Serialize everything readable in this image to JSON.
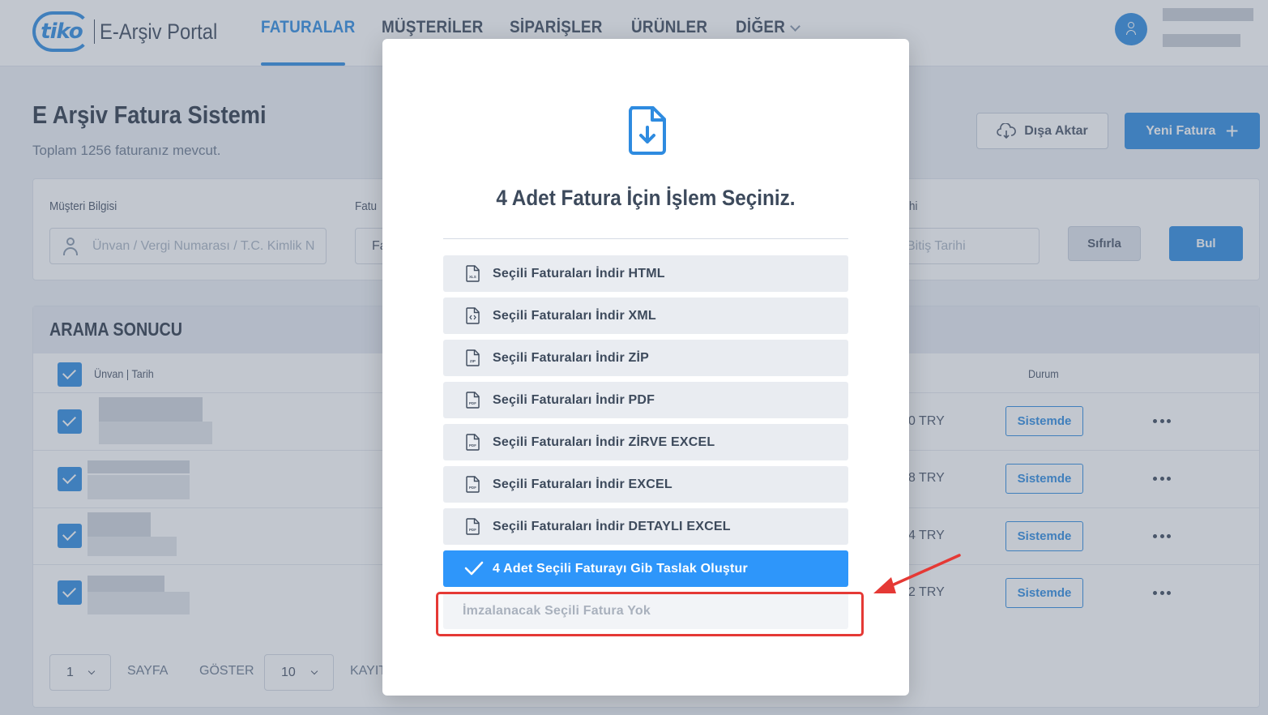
{
  "navbar": {
    "logo_mark": "tiko",
    "logo_text": "E-Arşiv Portal",
    "tabs": [
      {
        "label": "FATURALAR",
        "active": true
      },
      {
        "label": "MÜŞTERİLER",
        "active": false
      },
      {
        "label": "SİPARİŞLER",
        "active": false
      },
      {
        "label": "ÜRÜNLER",
        "active": false
      },
      {
        "label": "DİĞER",
        "active": false
      }
    ]
  },
  "page": {
    "title": "E Arşiv Fatura Sistemi",
    "subtitle": "Toplam 1256 faturanız mevcut.",
    "export_label": "Dışa Aktar",
    "new_invoice_label": "Yeni Fatura"
  },
  "filters": {
    "customer_label": "Müşteri Bilgisi",
    "customer_placeholder": "Ünvan / Vergi Numarası / T.C. Kimlik N",
    "invoice_label_partial": "Fatu",
    "invoice_input_partial": "Fa",
    "date_label_partial": "hi",
    "end_date_placeholder": "Bitiş Tarihi",
    "reset_label": "Sıfırla",
    "find_label": "Bul"
  },
  "results": {
    "title": "ARAMA SONUCU",
    "col_name_date": "Ünvan | Tarih",
    "col_status": "Durum",
    "rows": [
      {
        "amount": "0 TRY",
        "status": "Sistemde"
      },
      {
        "amount": "8 TRY",
        "status": "Sistemde"
      },
      {
        "amount": "4 TRY",
        "status": "Sistemde"
      },
      {
        "amount": "2 TRY",
        "status": "Sistemde"
      }
    ],
    "pager": {
      "page_value": "1",
      "page_label": "SAYFA",
      "show_label": "GÖSTER",
      "per_page_value": "10",
      "records_label_partial": "KAYIT"
    }
  },
  "modal": {
    "title": "4 Adet Fatura İçin İşlem Seçiniz.",
    "options": [
      {
        "label": "Seçili Faturaları İndir HTML",
        "icon": "xls-file-icon",
        "icon_tag": "XLS"
      },
      {
        "label": "Seçili Faturaları İndir XML",
        "icon": "code-file-icon",
        "icon_tag": ""
      },
      {
        "label": "Seçili Faturaları İndir ZİP",
        "icon": "zip-file-icon",
        "icon_tag": "ZIP"
      },
      {
        "label": "Seçili Faturaları İndir PDF",
        "icon": "pdf-file-icon",
        "icon_tag": "PDF"
      },
      {
        "label": "Seçili Faturaları İndir ZİRVE EXCEL",
        "icon": "pdf-file-icon",
        "icon_tag": "PDF"
      },
      {
        "label": "Seçili Faturaları İndir EXCEL",
        "icon": "pdf-file-icon",
        "icon_tag": "PDF"
      },
      {
        "label": "Seçili Faturaları İndir DETAYLI EXCEL",
        "icon": "pdf-file-icon",
        "icon_tag": "PDF"
      }
    ],
    "primary_action": "4 Adet Seçili Faturayı Gib Taslak Oluştur",
    "disabled_action": "İmzalanacak Seçili Fatura Yok"
  },
  "colors": {
    "accent": "#2e8be0",
    "primary_button": "#2e96fa",
    "annotation_red": "#e53935"
  }
}
